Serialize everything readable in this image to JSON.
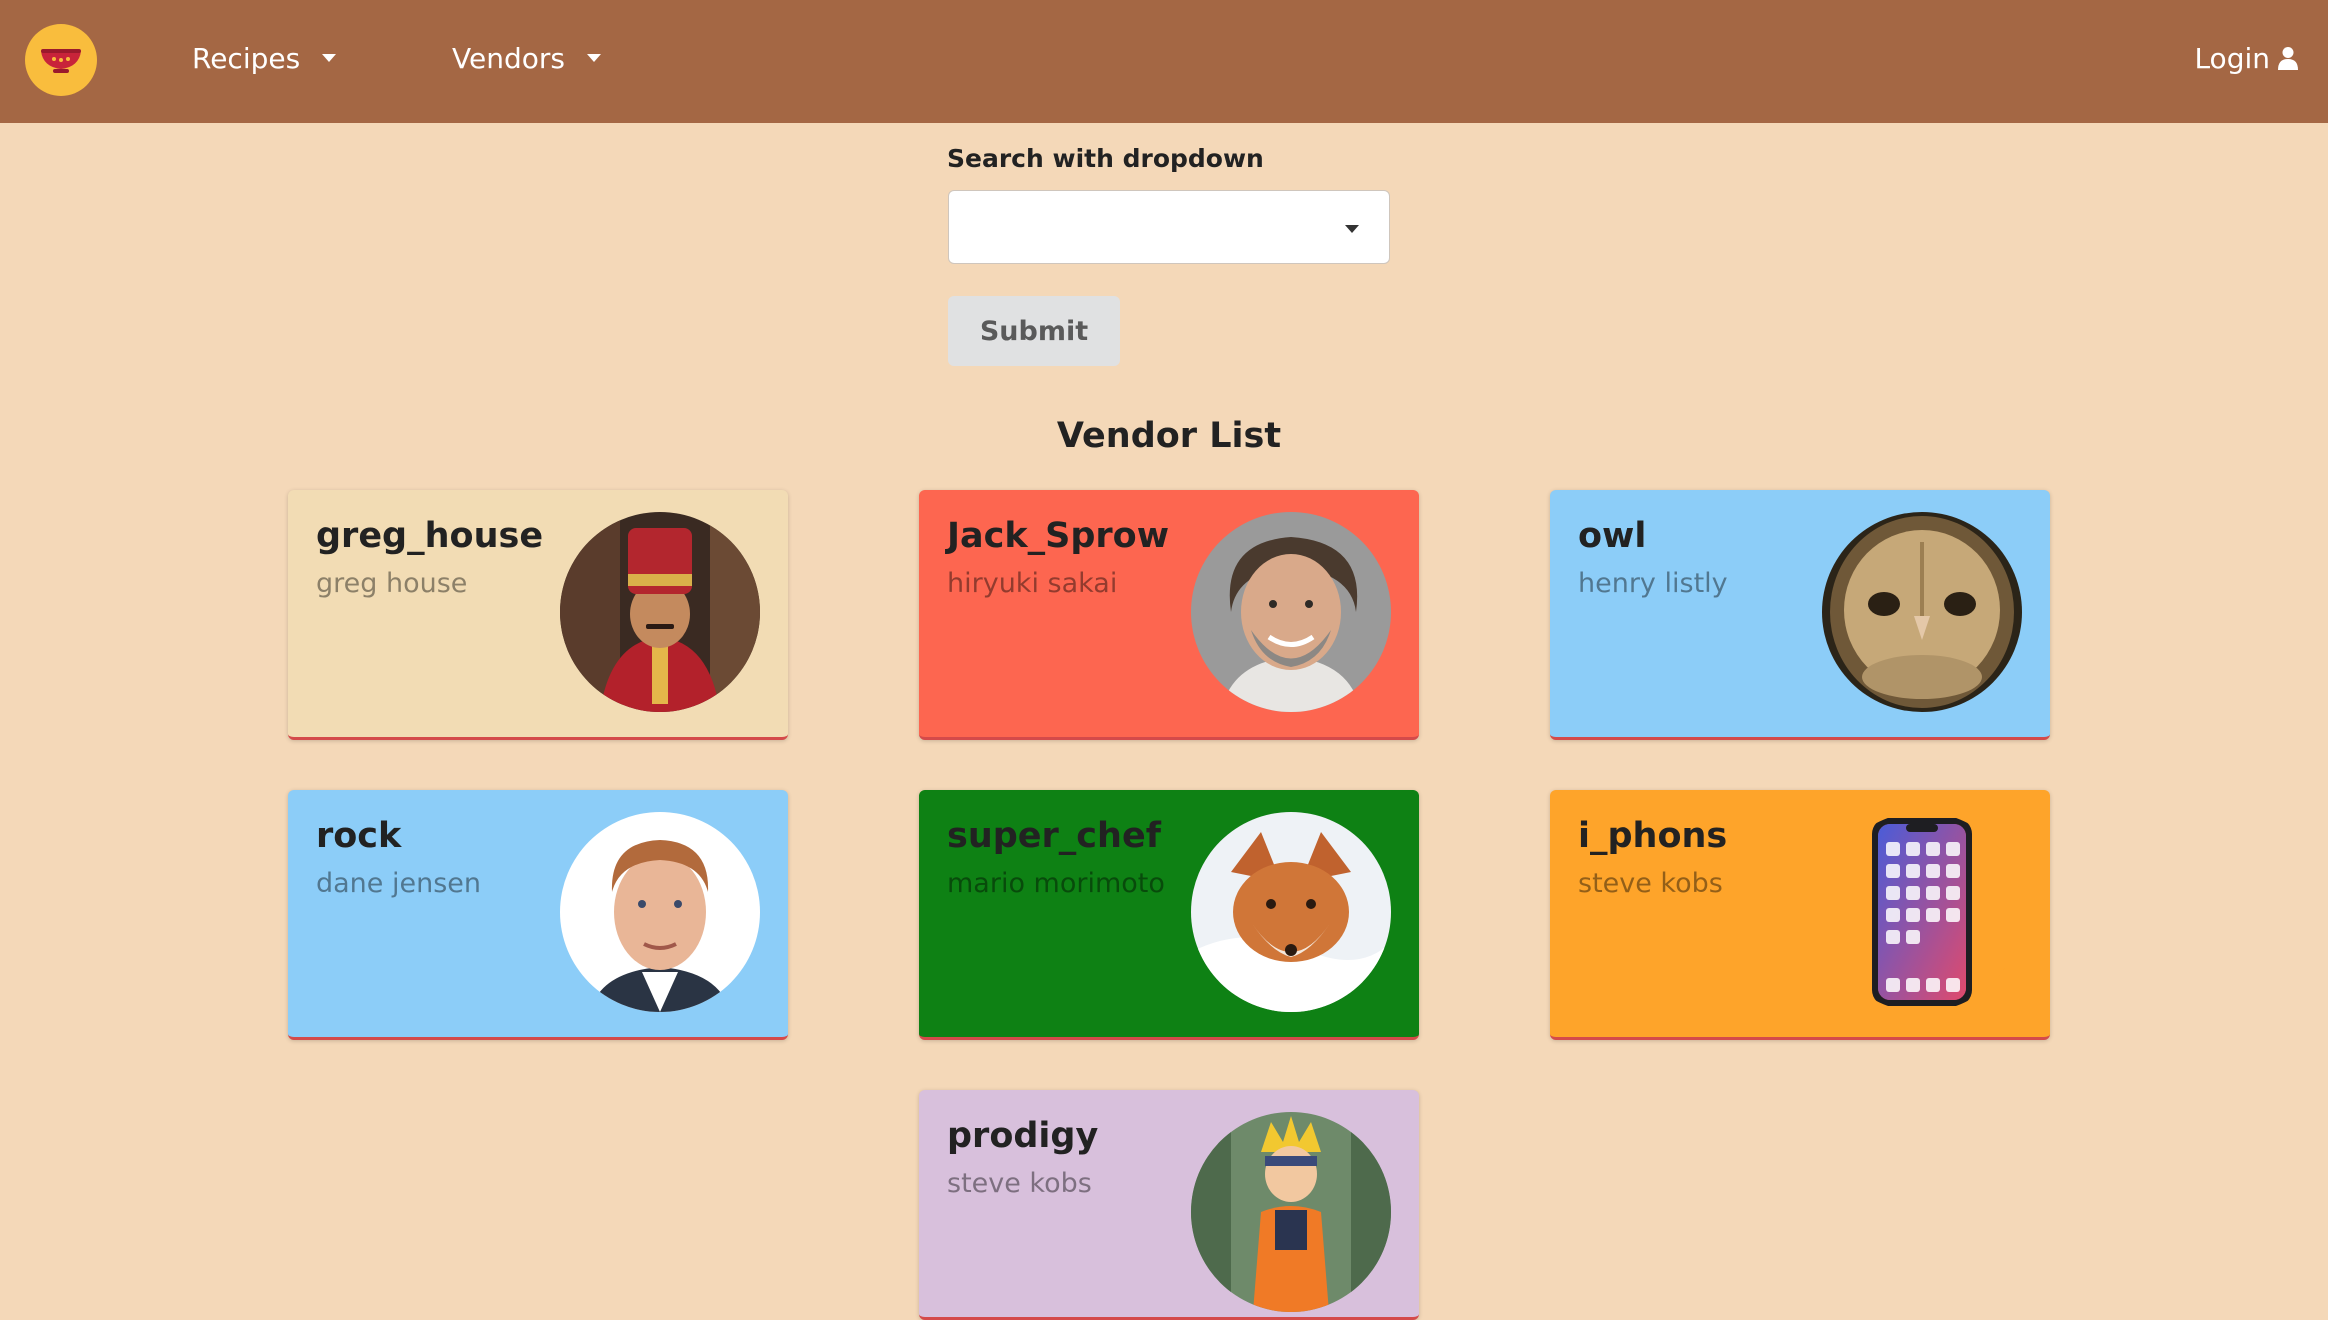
{
  "nav": {
    "logo_icon": "bowl-icon",
    "items": [
      {
        "label": "Recipes"
      },
      {
        "label": "Vendors"
      }
    ],
    "login_label": "Login",
    "login_icon": "user-icon"
  },
  "search": {
    "label": "Search with dropdown",
    "dropdown_value": "",
    "submit_label": "Submit"
  },
  "vendor_list": {
    "title": "Vendor List",
    "vendors": [
      {
        "username": "greg_house",
        "name": "greg house",
        "color": "#f2dcb4",
        "avatar": "chef-photo"
      },
      {
        "username": "Jack_Sprow",
        "name": "hiryuki sakai",
        "color": "#fd6650",
        "avatar": "man-photo"
      },
      {
        "username": "owl",
        "name": "henry listly",
        "color": "#8ccdf8",
        "avatar": "owl-photo"
      },
      {
        "username": "rock",
        "name": "dane jensen",
        "color": "#8ccdf8",
        "avatar": "man-photo"
      },
      {
        "username": "super_chef",
        "name": "mario morimoto",
        "color": "#0e8114",
        "avatar": "fox-photo"
      },
      {
        "username": "i_phons",
        "name": "steve kobs",
        "color": "#fea42a",
        "avatar": "phone-photo"
      },
      {
        "username": "prodigy",
        "name": "steve kobs",
        "color": "#d8c0dc",
        "avatar": "anime-character-photo"
      }
    ]
  },
  "colors": {
    "navbar": "#a46744",
    "page_background": "#f4d8b8",
    "logo": "#f9bd3d"
  }
}
